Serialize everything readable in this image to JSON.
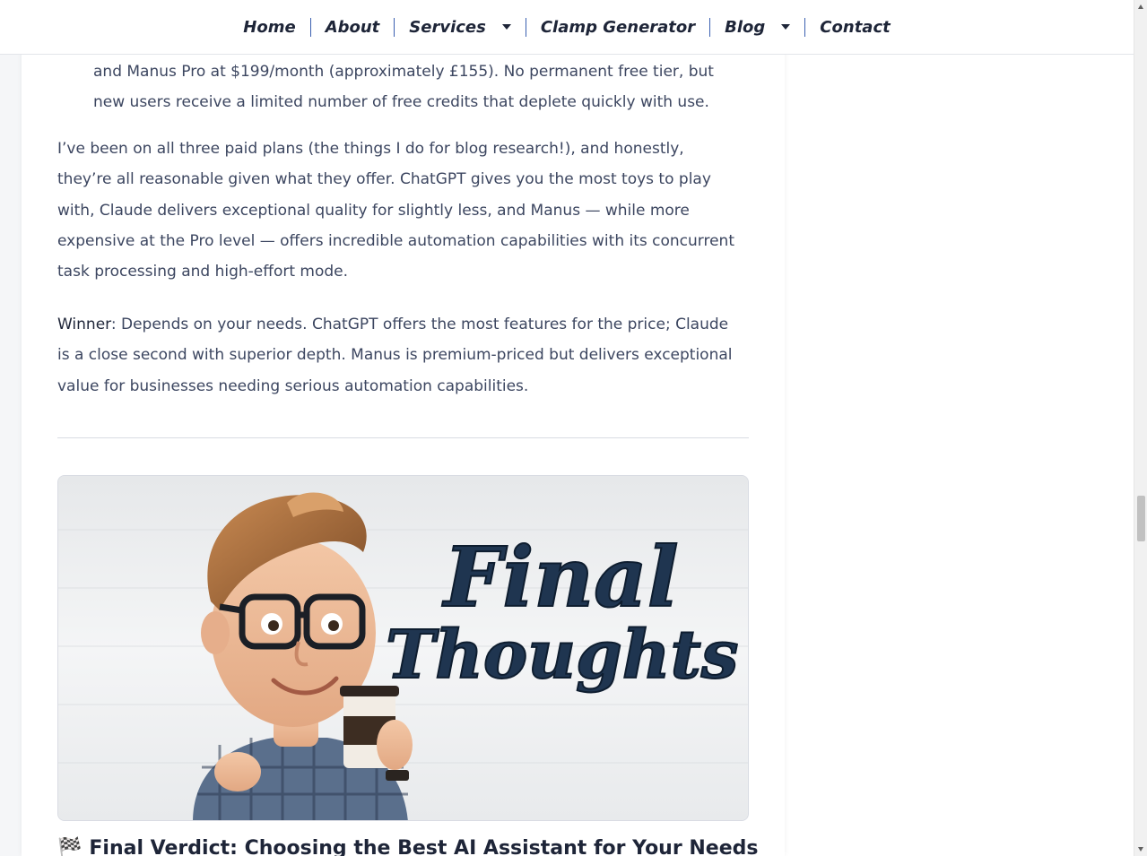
{
  "nav": {
    "items": [
      {
        "label": "Home"
      },
      {
        "label": "About"
      },
      {
        "label": "Services",
        "dropdown": true
      },
      {
        "label": "Clamp Generator"
      },
      {
        "label": "Blog",
        "dropdown": true
      },
      {
        "label": "Contact"
      }
    ]
  },
  "article": {
    "list_tail": "and Manus Pro at $199/month (approximately £155). No permanent free tier, but new users receive a limited number of free credits that deplete quickly with use.",
    "paragraph1": "I’ve been on all three paid plans (the things I do for blog research!), and honestly, they’re all reasonable given what they offer. ChatGPT gives you the most toys to play with, Claude delivers exceptional quality for slightly less, and Manus — while more expensive at the Pro level — offers incredible automation capabilities with its concurrent task processing and high-effort mode.",
    "winner_label": "Winner",
    "winner_text": ": Depends on your needs. ChatGPT offers the most features for the price; Claude is a close second with superior depth. Manus is premium-priced but delivers exceptional value for businesses needing serious automation capabilities.",
    "image_text_line1": "Final",
    "image_text_line2": "Thoughts",
    "heading_icon": "🏁",
    "heading": "Final Verdict: Choosing the Best AI Assistant for Your Needs"
  },
  "colors": {
    "text": "#3c4660",
    "heading": "#1e2538",
    "nav_separator": "#3a5fb0",
    "image_lettering": "#1f3550"
  },
  "icons": {
    "dropdown": "caret-down-icon",
    "heading": "chequered-flag-icon"
  }
}
